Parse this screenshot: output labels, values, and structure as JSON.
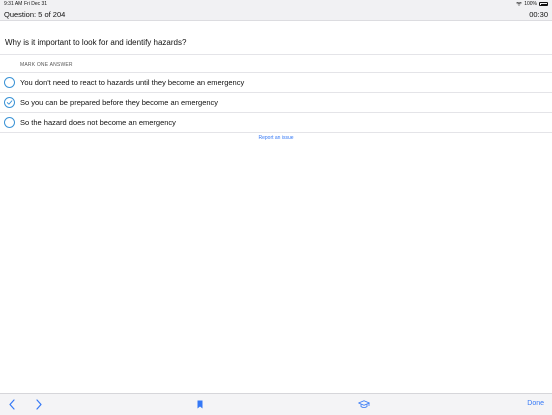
{
  "status_bar": {
    "time": "9:31 AM",
    "date": "Fri Dec 31",
    "battery_percent": "100%"
  },
  "header": {
    "question_counter": "Question: 5 of 204",
    "timer": "00:30"
  },
  "question": {
    "text": "Why is it important to look for and identify hazards?",
    "instruction": "MARK ONE ANSWER",
    "answers": [
      {
        "text": "You don't need to react to hazards until they become an emergency",
        "selected": false
      },
      {
        "text": "So you can be prepared before they become an emergency",
        "selected": true
      },
      {
        "text": "So the hazard does not become an emergency",
        "selected": false
      }
    ]
  },
  "report_link": "Report an issue",
  "toolbar": {
    "done_label": "Done",
    "icons": [
      "back-chevron-icon",
      "forward-chevron-icon",
      "bookmark-icon",
      "graduation-cap-icon"
    ]
  },
  "colors": {
    "accent": "#3478f6",
    "radio": "#3b93d6",
    "bar_background": "#f1f1f3"
  }
}
